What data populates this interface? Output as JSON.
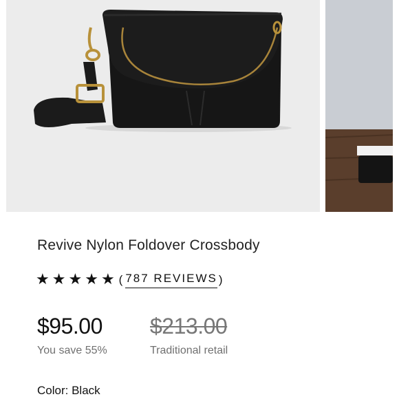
{
  "product": {
    "title": "Revive Nylon Foldover Crossbody",
    "rating": 5,
    "reviews_open": "(",
    "reviews_label": "787 REVIEWS",
    "reviews_close": ")",
    "price": "$95.00",
    "savings": "You save 55%",
    "retail_price": "$213.00",
    "retail_label": "Traditional retail",
    "color_label": "Color:",
    "color_value": "Black"
  },
  "icons": {
    "star": "star-icon"
  },
  "colors": {
    "text": "#1a1a1a",
    "muted": "#707070",
    "image_bg": "#ececec",
    "bag": "#151515",
    "hardware": "#b8913a"
  }
}
